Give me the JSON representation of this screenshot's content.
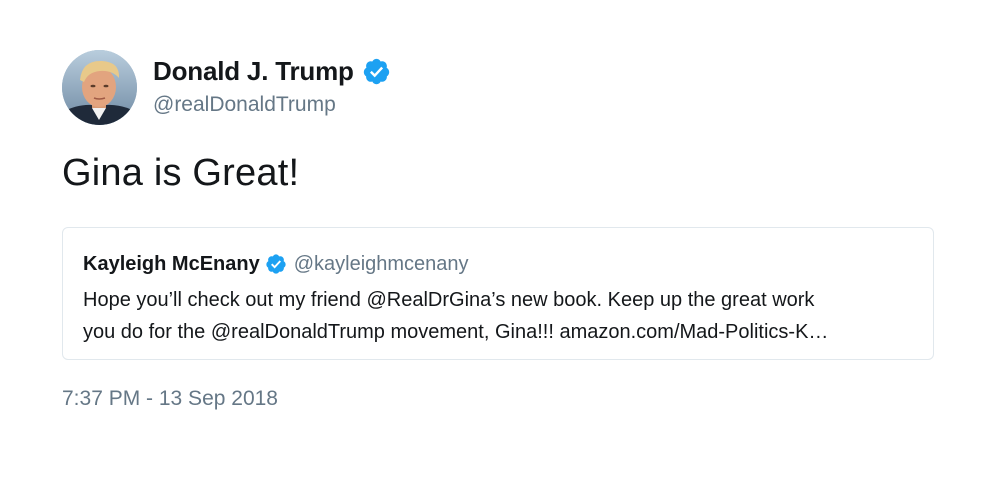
{
  "author": {
    "display_name": "Donald J. Trump",
    "handle": "@realDonaldTrump",
    "verified": true,
    "avatar_icon": "profile-photo"
  },
  "tweet": {
    "text": "Gina is Great!",
    "timestamp": "7:37 PM - 13 Sep 2018"
  },
  "quoted_tweet": {
    "display_name": "Kayleigh McEnany",
    "handle": "@kayleighmcenany",
    "verified": true,
    "text_lines": [
      "Hope you’ll check out my friend @RealDrGina’s new book.  Keep up the great work",
      "you do for the @realDonaldTrump movement, Gina!!!  amazon.com/Mad-Politics-K…"
    ]
  },
  "colors": {
    "verified_blue": "#1da1f2",
    "secondary_text": "#657786",
    "primary_text": "#14171a",
    "card_border": "#e1e8ed"
  }
}
